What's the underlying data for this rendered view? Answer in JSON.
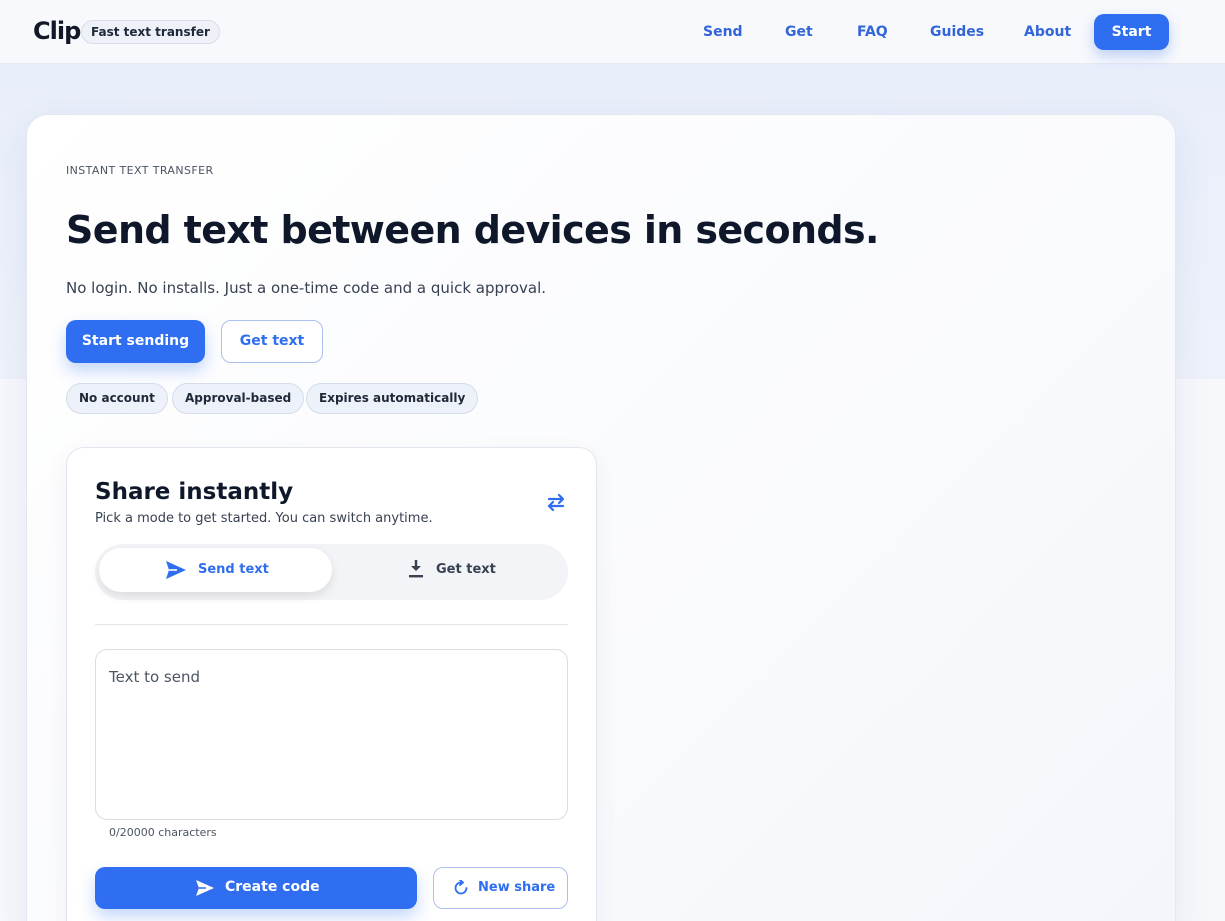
{
  "brand": {
    "logo": "Clip",
    "tagline": "Fast text transfer"
  },
  "nav": {
    "items": [
      "Send",
      "Get",
      "FAQ",
      "Guides",
      "About"
    ],
    "cta": "Start"
  },
  "hero": {
    "eyebrow": "INSTANT TEXT TRANSFER",
    "title": "Send text between devices in seconds.",
    "subtitle": "No login. No installs. Just a one-time code and a quick approval.",
    "primary_button": "Start sending",
    "secondary_button": "Get text",
    "chips": [
      "No account",
      "Approval-based",
      "Expires automatically"
    ]
  },
  "share": {
    "title": "Share instantly",
    "subtitle": "Pick a mode to get started. You can switch anytime.",
    "swap_icon": "swap-arrows-icon",
    "modes": [
      {
        "label": "Send text",
        "icon": "send-icon",
        "active": true
      },
      {
        "label": "Get text",
        "icon": "download-icon",
        "active": false
      }
    ],
    "input": {
      "placeholder": "Text to send",
      "value": ""
    },
    "counter": "0/20000 characters",
    "create_button": "Create code",
    "new_button": "New share"
  },
  "colors": {
    "accent": "#2f6ef0",
    "nav_link": "#3265d9",
    "text": "#0f172a"
  }
}
